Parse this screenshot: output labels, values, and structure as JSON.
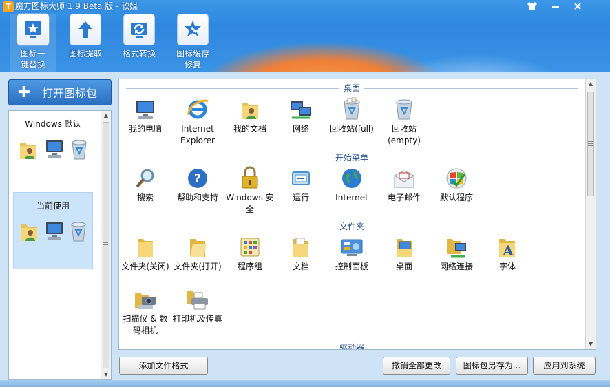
{
  "window": {
    "title": "魔方图标大师 1.9 Beta 版 - 软媒",
    "logo_text": "T",
    "controls": [
      "skin-icon",
      "minimize-icon",
      "close-icon"
    ]
  },
  "toolbar": {
    "items": [
      {
        "label": "图标一键替换",
        "icon": "star-icon",
        "active": true
      },
      {
        "label": "图标提取",
        "icon": "arrow-up-icon",
        "active": false
      },
      {
        "label": "格式转换",
        "icon": "refresh-icon",
        "active": false
      },
      {
        "label": "图标缓存修复",
        "icon": "wrench-star-icon",
        "active": false
      }
    ]
  },
  "sidebar": {
    "open_button": "打开图标包",
    "packs": [
      {
        "name": "Windows 默认",
        "selected": false
      },
      {
        "name": "当前使用",
        "selected": true
      }
    ]
  },
  "sections": [
    {
      "title": "桌面",
      "items": [
        {
          "name": "我的电脑",
          "icon": "computer-icon"
        },
        {
          "name": "Internet Explorer",
          "icon": "ie-icon"
        },
        {
          "name": "我的文档",
          "icon": "documents-icon"
        },
        {
          "name": "网络",
          "icon": "network-icon"
        },
        {
          "name": "回收站(full)",
          "icon": "recycle-full-icon"
        },
        {
          "name": "回收站(empty)",
          "icon": "recycle-empty-icon"
        }
      ]
    },
    {
      "title": "开始菜单",
      "items": [
        {
          "name": "搜索",
          "icon": "search-icon"
        },
        {
          "name": "帮助和支持",
          "icon": "help-icon"
        },
        {
          "name": "Windows 安全",
          "icon": "lock-icon"
        },
        {
          "name": "运行",
          "icon": "run-icon"
        },
        {
          "name": "Internet",
          "icon": "globe-icon"
        },
        {
          "name": "电子邮件",
          "icon": "mail-icon"
        },
        {
          "name": "默认程序",
          "icon": "default-programs-icon"
        }
      ]
    },
    {
      "title": "文件夹",
      "items": [
        {
          "name": "文件夹(关闭)",
          "icon": "folder-closed-icon"
        },
        {
          "name": "文件夹(打开)",
          "icon": "folder-open-icon"
        },
        {
          "name": "程序组",
          "icon": "program-group-icon"
        },
        {
          "name": "文档",
          "icon": "document-folder-icon"
        },
        {
          "name": "控制面板",
          "icon": "control-panel-icon"
        },
        {
          "name": "桌面",
          "icon": "desktop-folder-icon"
        },
        {
          "name": "网络连接",
          "icon": "network-connections-icon"
        },
        {
          "name": "字体",
          "icon": "fonts-icon"
        },
        {
          "name": "扫描仪 & 数码相机",
          "icon": "scanner-icon"
        },
        {
          "name": "打印机及传真",
          "icon": "printer-icon"
        }
      ]
    },
    {
      "title": "驱动器",
      "items": []
    }
  ],
  "buttons": {
    "add_format": "添加文件格式",
    "revert_all": "撤销全部更改",
    "save_pack_as": "图标包另存为...",
    "apply": "应用到系统"
  },
  "colors": {
    "band": "#2f88de",
    "accent_orange": "#ef7f37",
    "selected_bg": "#cce4fa",
    "section_title": "#1f4e8a"
  }
}
